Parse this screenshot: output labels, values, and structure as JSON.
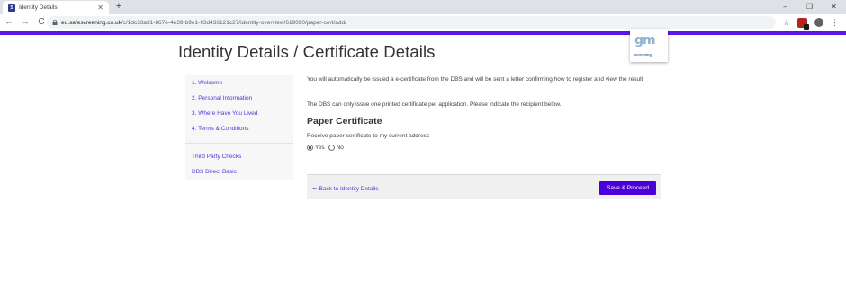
{
  "browser": {
    "tab_title": "Identity Details",
    "tab_close": "✕",
    "new_tab": "+",
    "url_host": "eu.safescreening.co.uk",
    "url_path": "/c/1dc33a31-867e-4e39-b9e1-93d436121c27/identity-overview/619090/paper-cert/add/",
    "win_minimize": "–",
    "win_restore": "❐",
    "win_close": "✕",
    "nav_back": "←",
    "nav_forward": "→",
    "nav_reload": "C",
    "star": "☆",
    "menu": "⋮"
  },
  "page": {
    "title": "Identity Details / Certificate Details",
    "logo_mark": "gm",
    "logo_text": "screening"
  },
  "sidebar": {
    "items": [
      {
        "label": "1. Welcome"
      },
      {
        "label": "2. Personal Information"
      },
      {
        "label": "3. Where Have You Lived"
      },
      {
        "label": "4. Terms & Conditions"
      },
      {
        "label": "Third Party Checks"
      },
      {
        "label": "DBS Direct Basic"
      }
    ]
  },
  "main": {
    "intro": "You will automatically be issued a e-certificate from the DBS and will be sent a letter confirming how to register and view the result",
    "note": "The DBS can only issue one printed certificate per application. Please indicate the recipient below.",
    "section_title": "Paper Certificate",
    "question": "Receive paper certificate to my current address",
    "options": [
      {
        "label": "Yes",
        "checked": true
      },
      {
        "label": "No",
        "checked": false
      }
    ]
  },
  "footer": {
    "back_label": "Back to Identity Details",
    "proceed_label": "Save & Proceed"
  },
  "colors": {
    "accent": "#5a16e8",
    "button": "#4a00d9",
    "link": "#4a3cd6"
  }
}
